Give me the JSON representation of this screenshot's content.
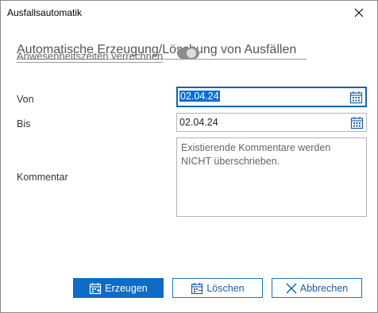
{
  "window": {
    "title": "Ausfallsautomatik",
    "close_icon": "close-icon"
  },
  "section": {
    "heading": "Automatische Erzeugung/Löschung von Ausfällen",
    "overlay_label": "Anwesenheitszeiten verrechnen",
    "toggle_state": "off"
  },
  "form": {
    "von_label": "Von",
    "von_value": "02.04.24",
    "bis_label": "Bis",
    "bis_value": "02.04.24",
    "kommentar_label": "Kommentar",
    "kommentar_placeholder": "Existierende Kommentare werden NICHT überschrieben."
  },
  "buttons": {
    "erzeugen": "Erzeugen",
    "loeschen": "Löschen",
    "abbrechen": "Abbrechen"
  },
  "colors": {
    "accent": "#0e6cc4",
    "focus_border": "#0e63b5"
  }
}
